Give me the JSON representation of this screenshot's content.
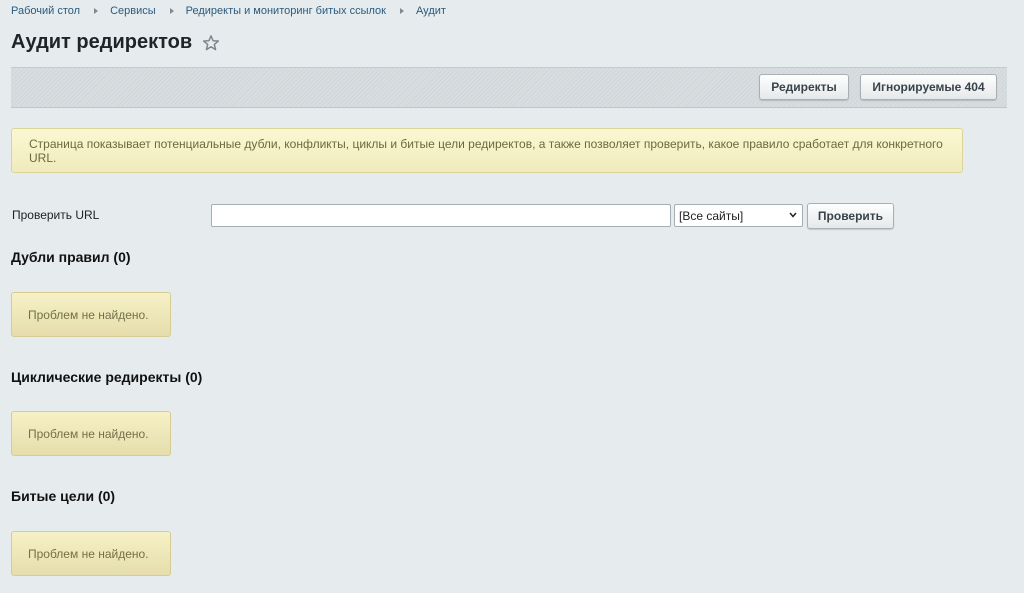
{
  "breadcrumb": [
    "Рабочий стол",
    "Сервисы",
    "Редиректы и мониторинг битых ссылок",
    "Аудит"
  ],
  "page_title": "Аудит редиректов",
  "toolbar": {
    "redirects_label": "Редиректы",
    "ignored_label": "Игнорируемые 404"
  },
  "info_text": "Страница показывает потенциальные дубли, конфликты, циклы и битые цели редиректов, а также позволяет проверить, какое правило сработает для конкретного URL.",
  "check_url": {
    "label": "Проверить URL",
    "value": "",
    "placeholder": "",
    "site_selected": "[Все сайты]",
    "button_label": "Проверить"
  },
  "sections": [
    {
      "title": "Дубли правил (0)",
      "empty_text": "Проблем не найдено."
    },
    {
      "title": "Циклические редиректы (0)",
      "empty_text": "Проблем не найдено."
    },
    {
      "title": "Битые цели (0)",
      "empty_text": "Проблем не найдено."
    }
  ],
  "icons": {
    "favorite": "star-icon",
    "select": "chevron-down-icon"
  },
  "colors": {
    "background": "#e6ecee",
    "info_bg": "#f6f1c6",
    "link": "#2a5a7e"
  }
}
